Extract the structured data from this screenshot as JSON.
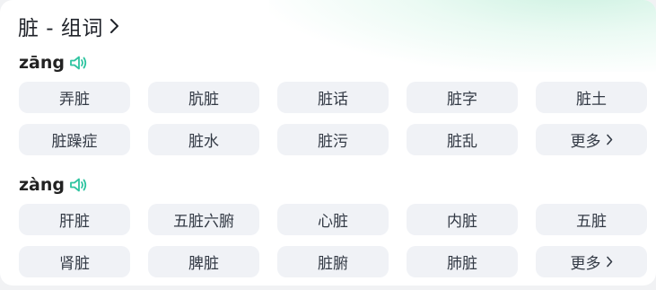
{
  "title": {
    "text": "脏 - 组词",
    "chevron_icon": "chevron-right-icon"
  },
  "readings": [
    {
      "pinyin": "zāng",
      "speaker_icon": "speaker-icon",
      "words": [
        "弄脏",
        "肮脏",
        "脏话",
        "脏字",
        "脏土",
        "脏躁症",
        "脏水",
        "脏污",
        "脏乱"
      ],
      "more_label": "更多"
    },
    {
      "pinyin": "zàng",
      "speaker_icon": "speaker-icon",
      "words": [
        "肝脏",
        "五脏六腑",
        "心脏",
        "内脏",
        "五脏",
        "肾脏",
        "脾脏",
        "脏腑",
        "肺脏"
      ],
      "more_label": "更多"
    }
  ],
  "colors": {
    "accent_green": "#2ec4a0",
    "pill_bg": "#f0f2f6",
    "text_dark": "#1f2229"
  }
}
